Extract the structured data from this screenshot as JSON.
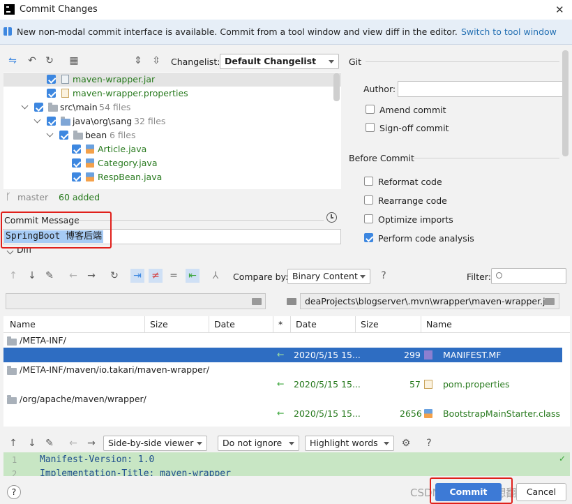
{
  "window": {
    "title": "Commit Changes",
    "close_glyph": "✕"
  },
  "banner": {
    "text": "New non-modal commit interface is available. Commit from a tool window and view diff in the editor.",
    "link": "Switch to tool window"
  },
  "changes_toolbar": {
    "changelist_label": "Changelist:",
    "changelist_value": "Default Changelist"
  },
  "tree": [
    {
      "label": "maven-wrapper.jar",
      "count": ""
    },
    {
      "label": "maven-wrapper.properties",
      "count": ""
    },
    {
      "label": "src\\main",
      "count": "54 files"
    },
    {
      "label": "java\\org\\sang",
      "count": "32 files"
    },
    {
      "label": "bean",
      "count": "6 files"
    },
    {
      "label": "Article.java",
      "count": ""
    },
    {
      "label": "Category.java",
      "count": ""
    },
    {
      "label": "RespBean.java",
      "count": ""
    }
  ],
  "status": {
    "branch": "master",
    "added": "60 added"
  },
  "commit_message": {
    "label": "Commit Message",
    "value": "SpringBoot 博客后端"
  },
  "git": {
    "title": "Git",
    "author_label": "Author:",
    "author_value": "",
    "amend": "Amend commit",
    "signoff": "Sign-off commit"
  },
  "before_commit": {
    "title": "Before Commit",
    "options": [
      {
        "label": "Reformat code",
        "checked": false
      },
      {
        "label": "Rearrange code",
        "checked": false
      },
      {
        "label": "Optimize imports",
        "checked": false
      },
      {
        "label": "Perform code analysis",
        "checked": true
      }
    ]
  },
  "diff": {
    "title": "Diff",
    "compare_label": "Compare by:",
    "compare_value": "Binary Content",
    "filter_label": "Filter:",
    "filter_value": "",
    "left_path": "",
    "right_path": "deaProjects\\blogserver\\.mvn\\wrapper\\maven-wrapper.jar",
    "columns": {
      "name": "Name",
      "size": "Size",
      "date": "Date",
      "star": "*",
      "date2": "Date",
      "size2": "Size",
      "name2": "Name"
    },
    "rows": [
      {
        "kind": "folder",
        "name": "/META-INF/"
      },
      {
        "kind": "file",
        "date": "2020/5/15 15...",
        "size": "299",
        "name": "MANIFEST.MF",
        "selected": true
      },
      {
        "kind": "folder",
        "name": "/META-INF/maven/io.takari/maven-wrapper/"
      },
      {
        "kind": "file",
        "date": "2020/5/15 15...",
        "size": "57",
        "name": "pom.properties",
        "selected": false
      },
      {
        "kind": "folder",
        "name": "/org/apache/maven/wrapper/"
      },
      {
        "kind": "file",
        "date": "2020/5/15 15...",
        "size": "2656",
        "name": "BootstrapMainStarter.class",
        "selected": false
      }
    ]
  },
  "bottom_toolbar": {
    "viewer": "Side-by-side viewer",
    "ignore": "Do not ignore",
    "highlight": "Highlight words"
  },
  "editor": {
    "lines": [
      {
        "num": "1",
        "text": "Manifest-Version: 1.0"
      },
      {
        "num": "2",
        "text": "Implementation-Title: maven-wrapper"
      }
    ]
  },
  "footer": {
    "help": "?",
    "commit": "Commit",
    "cancel": "Cancel",
    "watermark": "CSDN @一条咸鱼想翻身"
  }
}
